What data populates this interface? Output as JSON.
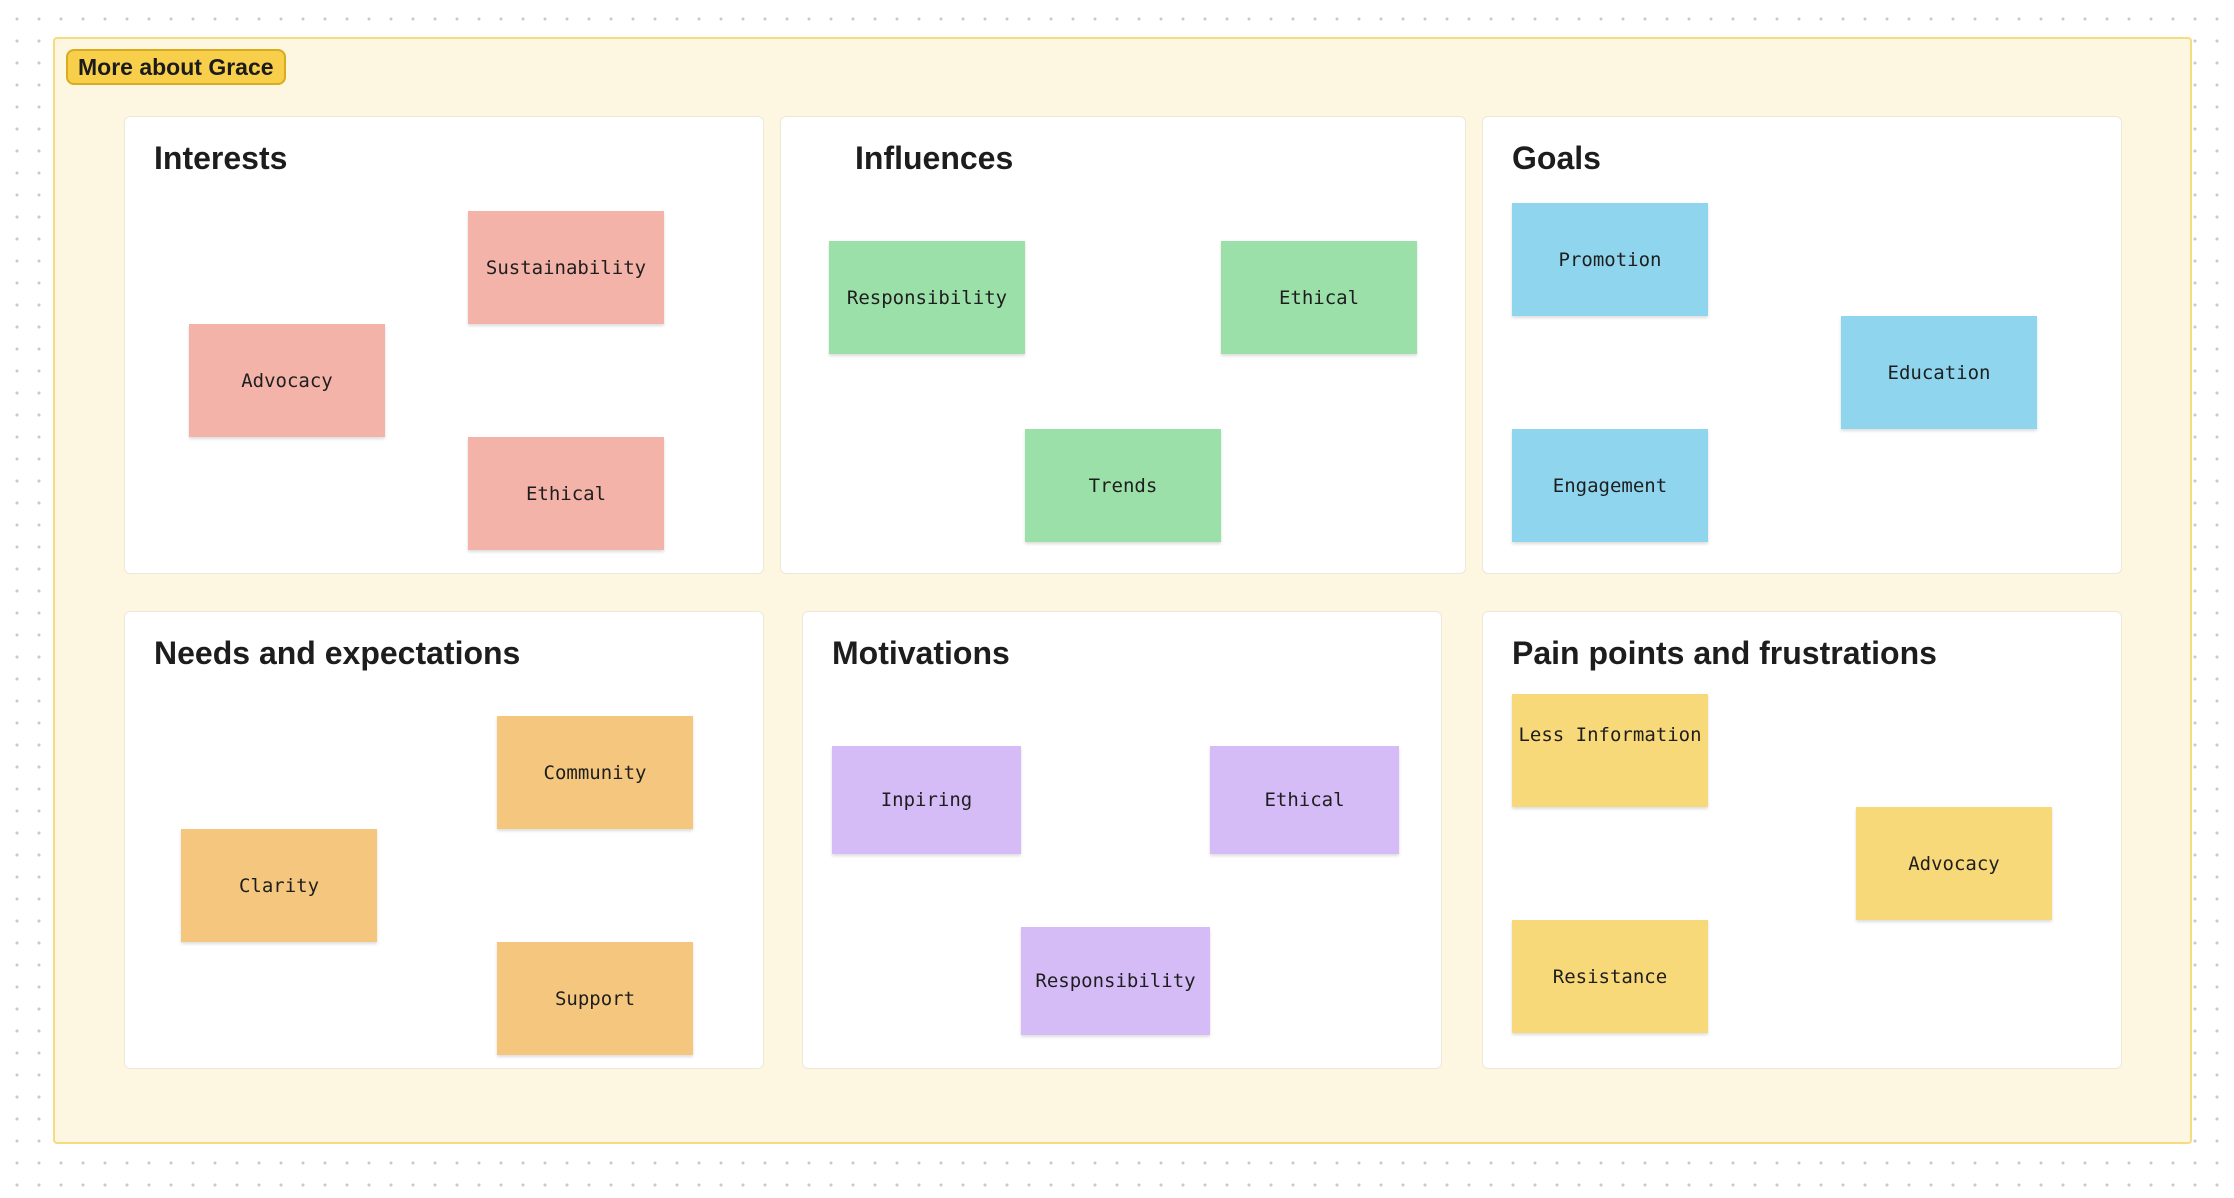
{
  "frame": {
    "label": "More about Grace",
    "background_color": "#fdf6e0",
    "label_color": "#f7cf4a"
  },
  "sections": {
    "interests": {
      "title": "Interests",
      "note_color": "#f4b3a9",
      "notes": [
        "Sustainability",
        "Advocacy",
        "Ethical"
      ]
    },
    "influences": {
      "title": "Influences",
      "note_color": "#9be0a8",
      "notes": [
        "Responsibility",
        "Ethical",
        "Trends"
      ]
    },
    "goals": {
      "title": "Goals",
      "note_color": "#8fd5ee",
      "notes": [
        "Promotion",
        "Education",
        "Engagement"
      ]
    },
    "needs": {
      "title": "Needs and expectations",
      "note_color": "#f5c77e",
      "notes": [
        "Community",
        "Clarity",
        "Support"
      ]
    },
    "motivations": {
      "title": "Motivations",
      "note_color": "#d5bcf7",
      "notes": [
        "Inpiring",
        "Ethical",
        "Responsibility"
      ]
    },
    "pain_points": {
      "title": "Pain points and frustrations",
      "note_color": "#f8d97a",
      "notes": [
        "Less Information",
        "Advocacy",
        "Resistance"
      ]
    }
  }
}
